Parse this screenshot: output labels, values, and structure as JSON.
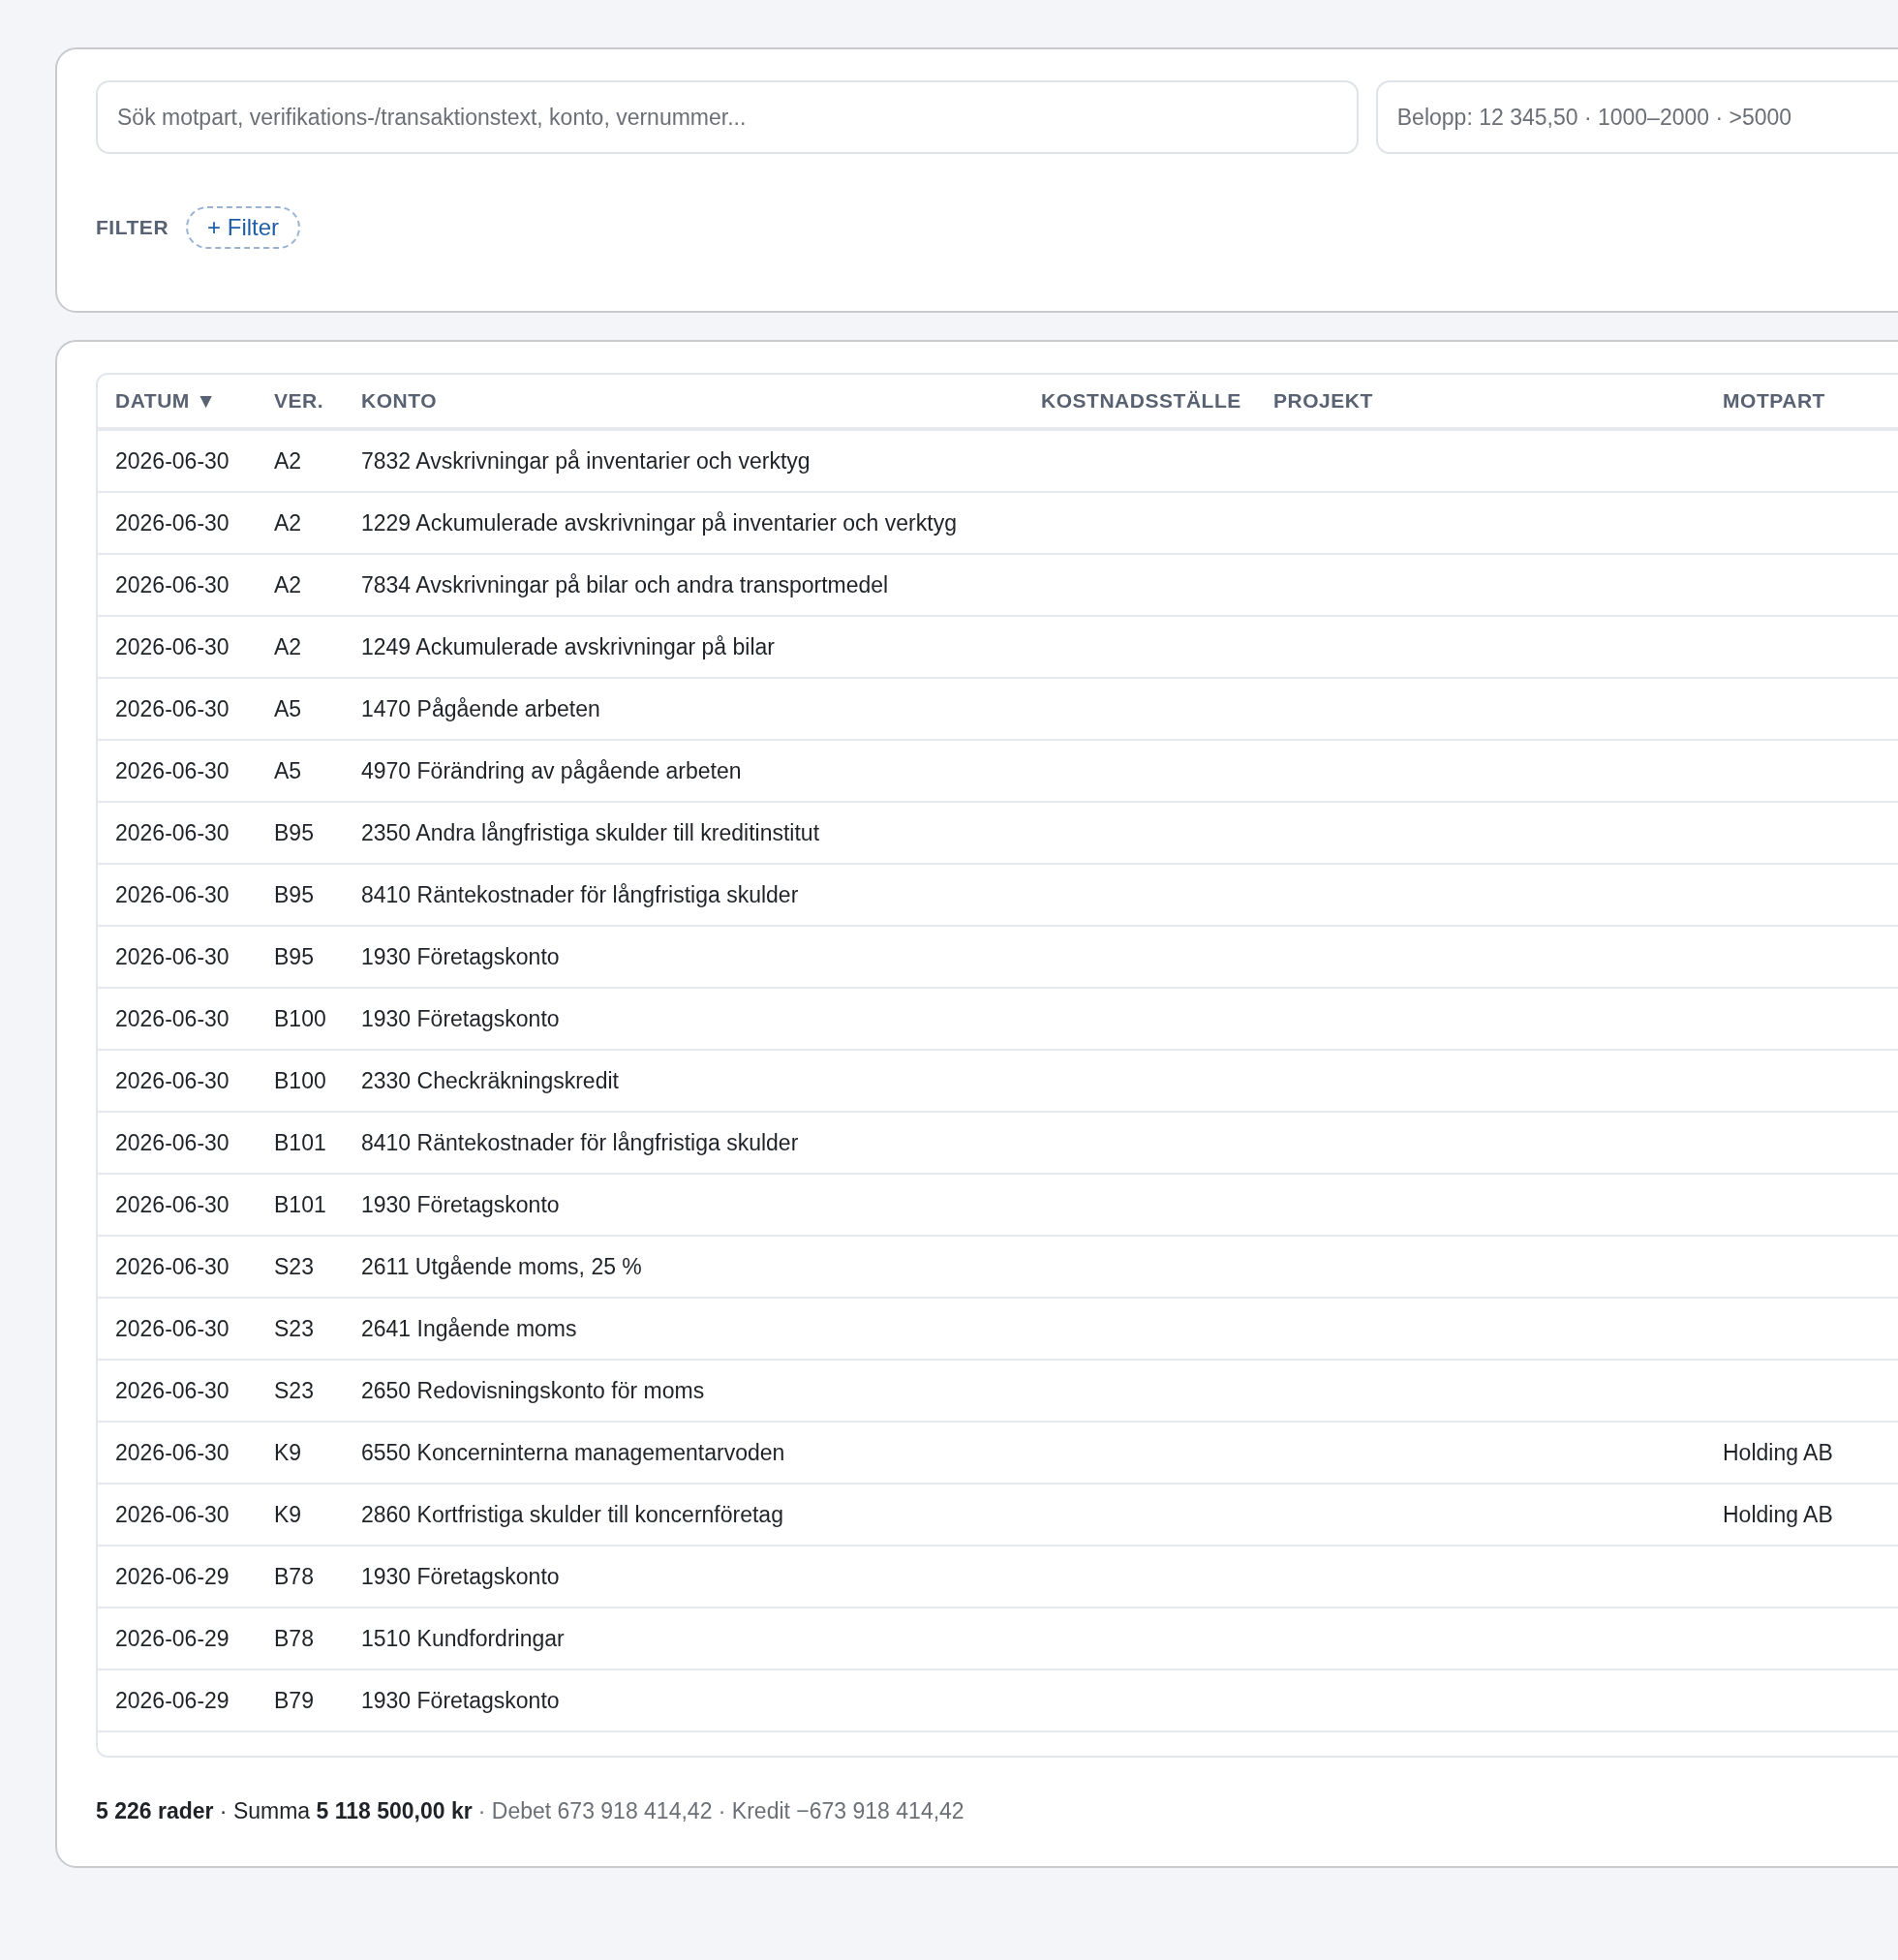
{
  "search": {
    "placeholder": "Sök motpart, verifikations-/transaktionstext, konto, vernummer..."
  },
  "amount_filter": {
    "placeholder": "Belopp: 12 345,50 · 1000–2000 · >5000"
  },
  "filter": {
    "label": "FILTER",
    "add_button": "+ Filter"
  },
  "table": {
    "columns": [
      {
        "label": "DATUM",
        "sort_indicator": "▼"
      },
      {
        "label": "VER."
      },
      {
        "label": "KONTO"
      },
      {
        "label": "KOSTNADSSTÄLLE"
      },
      {
        "label": "PROJEKT"
      },
      {
        "label": "MOTPART"
      }
    ],
    "rows": [
      {
        "date": "2026-06-30",
        "ver": "A2",
        "account": "7832 Avskrivningar på inventarier och verktyg"
      },
      {
        "date": "2026-06-30",
        "ver": "A2",
        "account": "1229 Ackumulerade avskrivningar på inventarier och verktyg"
      },
      {
        "date": "2026-06-30",
        "ver": "A2",
        "account": "7834 Avskrivningar på bilar och andra transportmedel"
      },
      {
        "date": "2026-06-30",
        "ver": "A2",
        "account": "1249 Ackumulerade avskrivningar på bilar"
      },
      {
        "date": "2026-06-30",
        "ver": "A5",
        "account": "1470 Pågående arbeten"
      },
      {
        "date": "2026-06-30",
        "ver": "A5",
        "account": "4970 Förändring av pågående arbeten"
      },
      {
        "date": "2026-06-30",
        "ver": "B95",
        "account": "2350 Andra långfristiga skulder till kreditinstitut"
      },
      {
        "date": "2026-06-30",
        "ver": "B95",
        "account": "8410 Räntekostnader för långfristiga skulder"
      },
      {
        "date": "2026-06-30",
        "ver": "B95",
        "account": "1930 Företagskonto"
      },
      {
        "date": "2026-06-30",
        "ver": "B100",
        "account": "1930 Företagskonto"
      },
      {
        "date": "2026-06-30",
        "ver": "B100",
        "account": "2330 Checkräkningskredit"
      },
      {
        "date": "2026-06-30",
        "ver": "B101",
        "account": "8410 Räntekostnader för långfristiga skulder"
      },
      {
        "date": "2026-06-30",
        "ver": "B101",
        "account": "1930 Företagskonto"
      },
      {
        "date": "2026-06-30",
        "ver": "S23",
        "account": "2611 Utgående moms, 25 %"
      },
      {
        "date": "2026-06-30",
        "ver": "S23",
        "account": "2641 Ingående moms"
      },
      {
        "date": "2026-06-30",
        "ver": "S23",
        "account": "2650 Redovisningskonto för moms"
      },
      {
        "date": "2026-06-30",
        "ver": "K9",
        "account": "6550 Koncerninterna managementarvoden",
        "counterparty": "Holding AB"
      },
      {
        "date": "2026-06-30",
        "ver": "K9",
        "account": "2860 Kortfristiga skulder till koncernföretag",
        "counterparty": "Holding AB"
      },
      {
        "date": "2026-06-29",
        "ver": "B78",
        "account": "1930 Företagskonto"
      },
      {
        "date": "2026-06-29",
        "ver": "B78",
        "account": "1510 Kundfordringar"
      },
      {
        "date": "2026-06-29",
        "ver": "B79",
        "account": "1930 Företagskonto"
      }
    ]
  },
  "footer": {
    "summary": "**5 226 rader** · Summa **5 118 500,00 kr**",
    "totals": "· Debet 673 918 414,42 · Kredit −673 918 414,42"
  }
}
